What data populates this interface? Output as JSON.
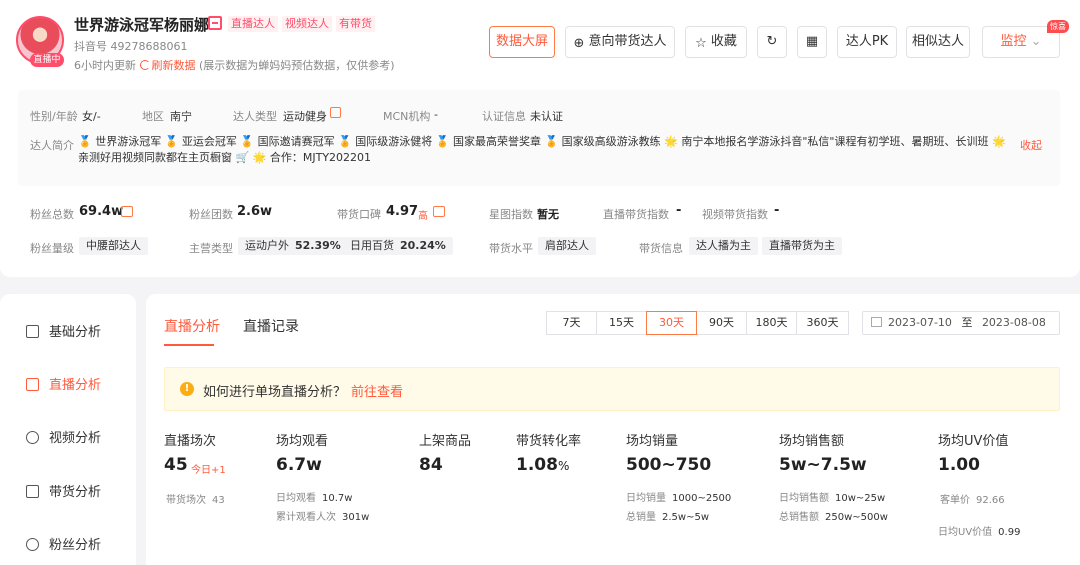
{
  "profile": {
    "name": "世界游泳冠军杨丽娜",
    "tags": [
      "直播达人",
      "视频达人",
      "有带货"
    ],
    "live_badge": "直播中",
    "douyin_id": "抖音号 49278688061",
    "update_text": "6小时内更新",
    "refresh_label": "刷新数据",
    "update_note": "(展示数据为蝉妈妈预估数据，仅供参考)"
  },
  "actions": {
    "data_screen": "数据大屏",
    "intent_goods": "意向带货达人",
    "favorite": "收藏",
    "pk": "达人PK",
    "similar": "相似达人",
    "monitor": "监控",
    "hot_badge": "惊喜"
  },
  "info": {
    "gender_age_label": "性别/年龄",
    "gender_age": "女/-",
    "region_label": "地区",
    "region": "南宁",
    "type_label": "达人类型",
    "type": "运动健身",
    "mcn_label": "MCN机构",
    "mcn": "-",
    "cert_label": "认证信息",
    "cert": "未认证",
    "bio_label": "达人简介",
    "bio": "🏅 世界游泳冠军 🏅 亚运会冠军 🏅 国际邀请赛冠军 🏅 国际级游泳健将 🏅 国家最高荣誉奖章 🏅 国家级高级游泳教练 🌟 南宁本地报名学游泳抖音\"私信\"课程有初学班、暑期班、长训班 🌟 亲测好用视频同款都在主页橱窗 🛒 🌟 合作：MJTY202201",
    "collapse": "收起"
  },
  "stats": {
    "fans_total_label": "粉丝总数",
    "fans_total": "69.4w",
    "fan_group_label": "粉丝团数",
    "fan_group": "2.6w",
    "reputation_label": "带货口碑",
    "reputation": "4.97",
    "reputation_level": "高",
    "star_label": "星图指数",
    "star": "暂无",
    "live_index_label": "直播带货指数",
    "live_index": "-",
    "video_index_label": "视频带货指数",
    "video_index": "-",
    "fans_level_label": "粉丝量级",
    "fans_level": "中腰部达人",
    "main_type_label": "主营类型",
    "main_types": [
      {
        "name": "运动户外",
        "pct": "52.39%"
      },
      {
        "name": "日用百货",
        "pct": "20.24%"
      }
    ],
    "goods_level_label": "带货水平",
    "goods_level": "肩部达人",
    "goods_info_label": "带货信息",
    "goods_info": [
      "达人播为主",
      "直播带货为主"
    ]
  },
  "sidebar": {
    "items": [
      {
        "label": "基础分析",
        "icon": "bar-chart-icon"
      },
      {
        "label": "直播分析",
        "icon": "live-icon"
      },
      {
        "label": "视频分析",
        "icon": "play-icon"
      },
      {
        "label": "带货分析",
        "icon": "bag-icon"
      },
      {
        "label": "粉丝分析",
        "icon": "user-icon"
      }
    ]
  },
  "main": {
    "tabs": [
      "直播分析",
      "直播记录"
    ],
    "ranges": [
      "7天",
      "15天",
      "30天",
      "90天",
      "180天",
      "360天"
    ],
    "active_range": "30天",
    "date_start": "2023-07-10",
    "date_sep": "至",
    "date_end": "2023-08-08",
    "notice": "如何进行单场直播分析？",
    "notice_link": "前往查看",
    "metrics": {
      "sessions_label": "直播场次",
      "sessions": "45",
      "sessions_today": "今日+1",
      "goods_sessions_label": "带货场次",
      "goods_sessions": "43",
      "views_label": "场均观看",
      "views": "6.7w",
      "daily_views_label": "日均观看",
      "daily_views": "10.7w",
      "total_viewers_label": "累计观看人次",
      "total_viewers": "301w",
      "products_label": "上架商品",
      "products": "84",
      "conversion_label": "带货转化率",
      "conversion": "1.08",
      "conversion_unit": "%",
      "sales_label": "场均销量",
      "sales": "500~750",
      "daily_sales_label": "日均销量",
      "daily_sales": "1000~2500",
      "total_sales_label": "总销量",
      "total_sales": "2.5w~5w",
      "revenue_label": "场均销售额",
      "revenue": "5w~7.5w",
      "daily_revenue_label": "日均销售额",
      "daily_revenue": "10w~25w",
      "total_revenue_label": "总销售额",
      "total_revenue": "250w~500w",
      "uv_label": "场均UV价值",
      "uv": "1.00",
      "avg_price_label": "客单价",
      "avg_price": "92.66",
      "daily_uv_label": "日均UV价值",
      "daily_uv": "0.99"
    }
  }
}
